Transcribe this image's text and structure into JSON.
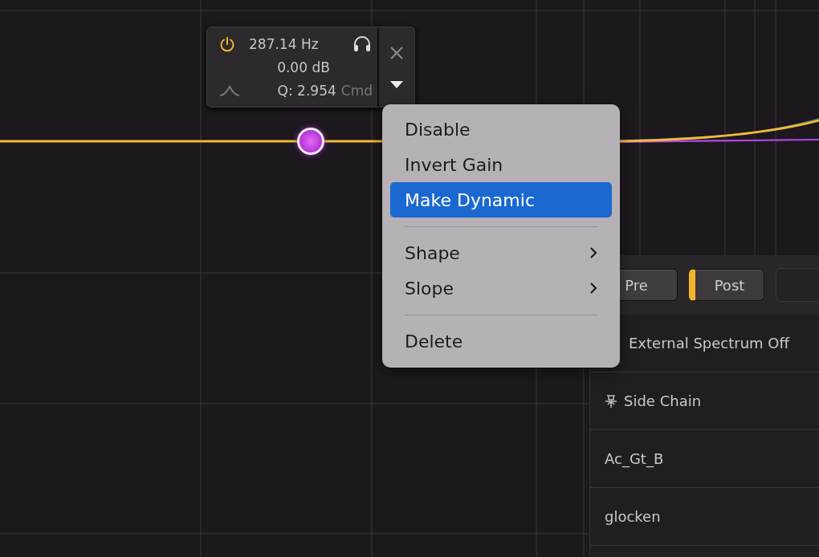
{
  "node_popup": {
    "power_on": true,
    "frequency": "287.14 Hz",
    "gain": "0.00 dB",
    "q": "Q: 2.954",
    "modifier": "Cmd"
  },
  "context_menu": {
    "items": [
      {
        "kind": "item",
        "label": "Disable",
        "selected": false
      },
      {
        "kind": "item",
        "label": "Invert Gain",
        "selected": false
      },
      {
        "kind": "item",
        "label": "Make Dynamic",
        "selected": true
      },
      {
        "kind": "separator"
      },
      {
        "kind": "submenu",
        "label": "Shape",
        "selected": false
      },
      {
        "kind": "submenu",
        "label": "Slope",
        "selected": false
      },
      {
        "kind": "separator"
      },
      {
        "kind": "item",
        "label": "Delete",
        "selected": false
      }
    ]
  },
  "side_panel": {
    "buttons": [
      {
        "label": "Pre",
        "selected": false
      },
      {
        "label": "Post",
        "selected": true
      }
    ],
    "spectrum_label": "External Spectrum Off",
    "sources": [
      {
        "kind": "sidechain",
        "label": "Side Chain"
      },
      {
        "kind": "track",
        "label": "Ac_Gt_B"
      },
      {
        "kind": "track",
        "label": "glocken"
      }
    ]
  }
}
